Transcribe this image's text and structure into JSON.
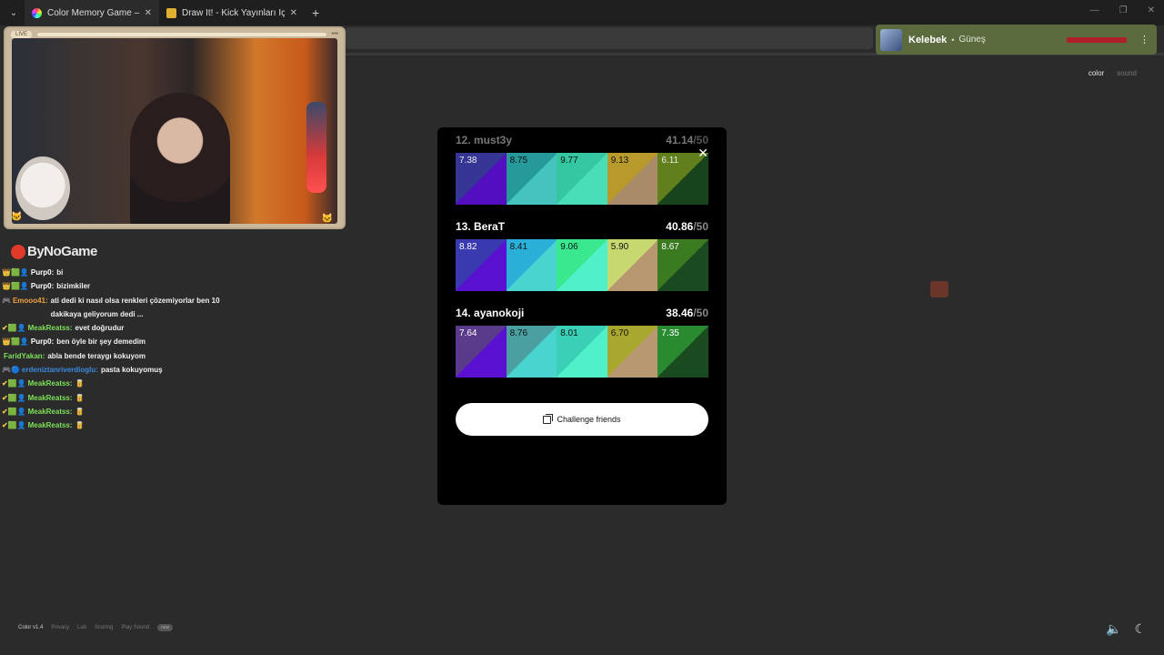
{
  "browser": {
    "tabs": [
      {
        "title": "Color Memory Game — How W",
        "active": true
      },
      {
        "title": "Draw It! - Kick Yayınları İçin Çizi",
        "active": false
      }
    ]
  },
  "stream": {
    "live_label": "LIVE",
    "brand": "ByNoGame"
  },
  "chat": [
    {
      "user": "Purp0",
      "text": "bi",
      "user_color": "#ffffff",
      "badges": "👑🟩👤"
    },
    {
      "user": "Purp0",
      "text": "bizimkiler",
      "user_color": "#ffffff",
      "badges": "👑🟩👤"
    },
    {
      "user": "Emooo41",
      "text": "ati dedi ki nasıl olsa renkleri çözemiyorlar ben 10 dakikaya geliyorum dedi ...",
      "user_color": "#f0a040",
      "badges": "🎮"
    },
    {
      "user": "MeakReatss",
      "text": "evet doğrudur",
      "user_color": "#7ee05a",
      "badges": "✔🟩👤"
    },
    {
      "user": "Purp0",
      "text": "ben öyle bir şey demedim",
      "user_color": "#ffffff",
      "badges": "👑🟩👤"
    },
    {
      "user": "FaridYakan",
      "text": "abla bende teraygı kokuyom",
      "user_color": "#7ee05a",
      "badges": ""
    },
    {
      "user": "erdeniztanriverdioglu",
      "text": "pasta kokuyomuş",
      "user_color": "#3a8ae0",
      "badges": "🎮🔵"
    },
    {
      "user": "MeakReatss",
      "text": "🥫",
      "user_color": "#7ee05a",
      "badges": "✔🟩👤"
    },
    {
      "user": "MeakReatss",
      "text": "🥫",
      "user_color": "#7ee05a",
      "badges": "✔🟩👤"
    },
    {
      "user": "MeakReatss",
      "text": "🥫",
      "user_color": "#7ee05a",
      "badges": "✔🟩👤"
    },
    {
      "user": "MeakReatss",
      "text": "🥫",
      "user_color": "#7ee05a",
      "badges": "✔🟩👤"
    }
  ],
  "notification": {
    "name": "Kelebek",
    "subtitle": "Güneş"
  },
  "modes": {
    "color": "color",
    "sound": "sound"
  },
  "leaderboard": {
    "entries": [
      {
        "rank_name": "12. must3y",
        "score": "41.14",
        "max": "/50",
        "faded": true,
        "swatches": [
          {
            "score": "7.38",
            "a": "#3a3aa0",
            "b": "#5a10d0",
            "dark": false
          },
          {
            "score": "8.75",
            "a": "#2aa8a8",
            "b": "#4ad4d0",
            "dark": true
          },
          {
            "score": "9.77",
            "a": "#3ad8b0",
            "b": "#50f0c8",
            "dark": true
          },
          {
            "score": "9.13",
            "a": "#c8a830",
            "b": "#b89870",
            "dark": true
          },
          {
            "score": "6.11",
            "a": "#6a8a20",
            "b": "#1a4a20",
            "dark": false
          }
        ]
      },
      {
        "rank_name": "13. BeraT",
        "score": "40.86",
        "max": "/50",
        "faded": false,
        "swatches": [
          {
            "score": "8.82",
            "a": "#3a3ab0",
            "b": "#5a10d0",
            "dark": false
          },
          {
            "score": "8.41",
            "a": "#2ab0d8",
            "b": "#4ad4d0",
            "dark": true
          },
          {
            "score": "9.06",
            "a": "#3ae890",
            "b": "#50f0c8",
            "dark": true
          },
          {
            "score": "5.90",
            "a": "#c8d870",
            "b": "#b89870",
            "dark": true
          },
          {
            "score": "8.67",
            "a": "#3a7a20",
            "b": "#1a4a20",
            "dark": false
          }
        ]
      },
      {
        "rank_name": "14. ayanokoji",
        "score": "38.46",
        "max": "/50",
        "faded": false,
        "swatches": [
          {
            "score": "7.64",
            "a": "#5a3a8a",
            "b": "#5a10d0",
            "dark": false
          },
          {
            "score": "8.76",
            "a": "#4aa0a0",
            "b": "#4ad4d0",
            "dark": true
          },
          {
            "score": "8.01",
            "a": "#3ad0b8",
            "b": "#50f0c8",
            "dark": true
          },
          {
            "score": "6.70",
            "a": "#a8a830",
            "b": "#b89870",
            "dark": true
          },
          {
            "score": "7.35",
            "a": "#2a8a30",
            "b": "#1a4a20",
            "dark": false
          }
        ]
      }
    ],
    "challenge_label": "Challenge friends"
  },
  "footer": {
    "version": "Color v1.4",
    "links": [
      "Privacy",
      "Lab",
      "Scoring",
      "Play Sound"
    ],
    "badge": "new"
  }
}
